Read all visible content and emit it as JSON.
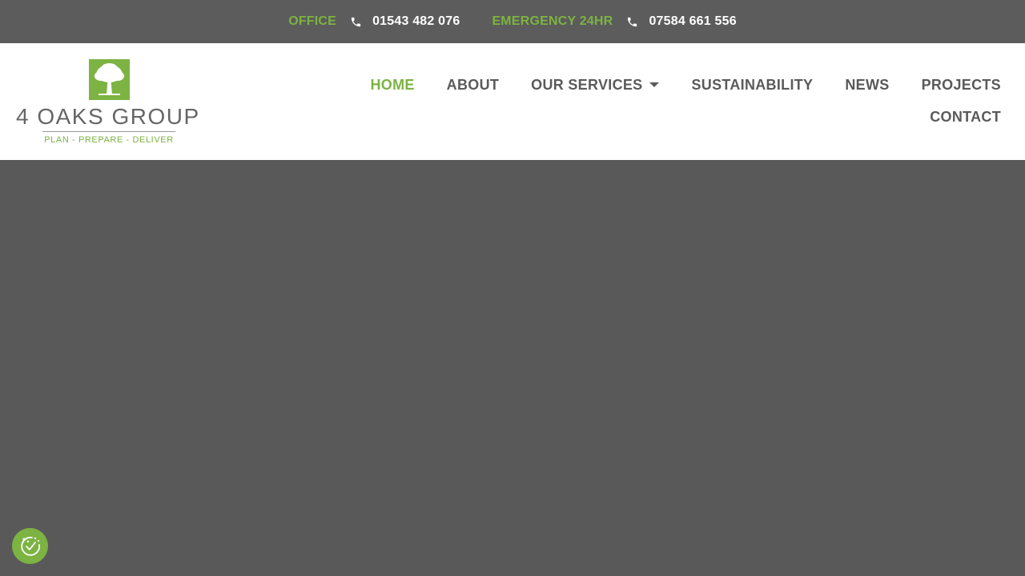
{
  "topbar": {
    "office_label": "OFFICE",
    "office_phone": "01543 482 076",
    "emergency_label": "EMERGENCY 24HR",
    "emergency_phone": "07584 661 556",
    "phone_icon": "phone-icon"
  },
  "logo": {
    "title": "4 OAKS GROUP",
    "tagline": "PLAN - PREPARE - DELIVER",
    "mark_icon": "oak-tree-icon"
  },
  "nav": {
    "items": [
      {
        "label": "HOME",
        "active": true
      },
      {
        "label": "ABOUT"
      },
      {
        "label": "OUR SERVICES",
        "has_dropdown": true
      },
      {
        "label": "SUSTAINABILITY"
      },
      {
        "label": "NEWS"
      },
      {
        "label": "PROJECTS"
      },
      {
        "label": "CONTACT"
      }
    ]
  },
  "consent": {
    "icon": "cookie-consent-icon"
  },
  "colors": {
    "accent": "#7cb342",
    "topbar_bg": "#5c5c5c",
    "hero_bg": "#595959",
    "nav_text": "#5a5a5a",
    "header_bg": "#ffffff"
  }
}
